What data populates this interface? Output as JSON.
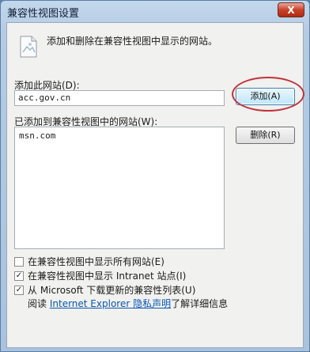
{
  "window": {
    "title": "兼容性视图设置",
    "close_glyph": "X"
  },
  "description": "添加和删除在兼容性视图中显示的网站。",
  "add_site": {
    "label": "添加此网站(D):",
    "value": "acc.gov.cn",
    "button": "添加(A)"
  },
  "added_sites": {
    "label": "已添加到兼容性视图中的网站(W):",
    "items": [
      "msn.com"
    ],
    "remove_button": "删除(R)"
  },
  "options": [
    {
      "label": "在兼容性视图中显示所有网站(E)",
      "checked": false
    },
    {
      "label": "在兼容性视图中显示 Intranet 站点(I)",
      "checked": true
    },
    {
      "label": "从 Microsoft 下载更新的兼容性列表(U)",
      "checked": true
    }
  ],
  "privacy": {
    "prefix": "阅读",
    "link": "Internet Explorer 隐私声明",
    "suffix": "了解详细信息"
  },
  "colors": {
    "annotation": "#c0333c",
    "link": "#0b58b8"
  },
  "icons": {
    "info": "page-globe-icon"
  }
}
